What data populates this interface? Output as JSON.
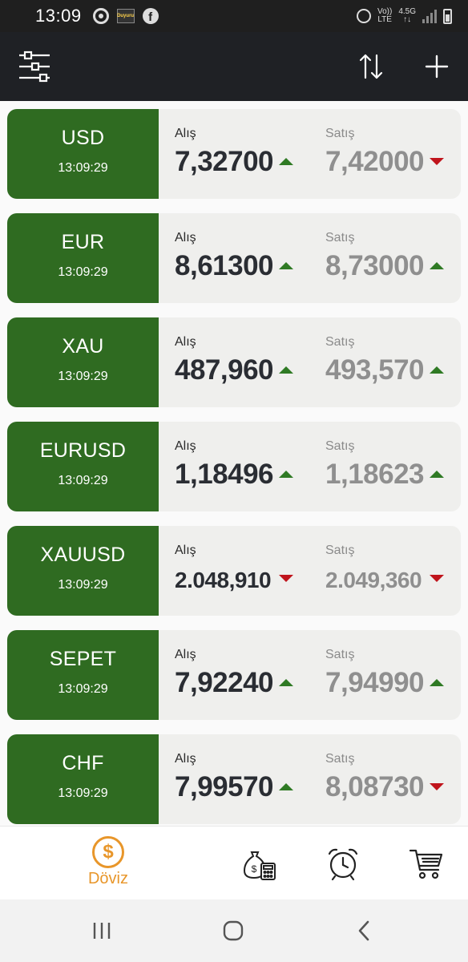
{
  "status_bar": {
    "time": "13:09",
    "app_icon_text": "Duyuru",
    "volte": "Vo))",
    "lte": "LTE",
    "network": "4.5G"
  },
  "colors": {
    "accent_green": "#2f6b21",
    "up_arrow": "#2f7a24",
    "down_arrow": "#c0141c",
    "active_tab": "#e8962a",
    "toolbar": "#1f2125"
  },
  "toolbar": {
    "filter_icon": "sliders-icon",
    "sort_icon": "sort-arrows-icon",
    "add_icon": "plus-icon"
  },
  "labels": {
    "buy": "Alış",
    "sell": "Satış"
  },
  "rates": [
    {
      "code": "USD",
      "time": "13:09:29",
      "buy": "7,32700",
      "buy_trend": "up",
      "sell": "7,42000",
      "sell_trend": "down"
    },
    {
      "code": "EUR",
      "time": "13:09:29",
      "buy": "8,61300",
      "buy_trend": "up",
      "sell": "8,73000",
      "sell_trend": "up"
    },
    {
      "code": "XAU",
      "time": "13:09:29",
      "buy": "487,960",
      "buy_trend": "up",
      "sell": "493,570",
      "sell_trend": "up"
    },
    {
      "code": "EURUSD",
      "time": "13:09:29",
      "buy": "1,18496",
      "buy_trend": "up",
      "sell": "1,18623",
      "sell_trend": "up"
    },
    {
      "code": "XAUUSD",
      "time": "13:09:29",
      "buy": "2.048,910",
      "buy_trend": "down",
      "sell": "2.049,360",
      "sell_trend": "down"
    },
    {
      "code": "SEPET",
      "time": "13:09:29",
      "buy": "7,92240",
      "buy_trend": "up",
      "sell": "7,94990",
      "sell_trend": "up"
    },
    {
      "code": "CHF",
      "time": "13:09:29",
      "buy": "7,99570",
      "buy_trend": "up",
      "sell": "8,08730",
      "sell_trend": "down"
    }
  ],
  "bottom_nav": {
    "active_label": "Döviz",
    "active_icon_glyph": "$",
    "items": [
      {
        "icon": "dollar-coin-icon",
        "label": "Döviz",
        "active": true
      },
      {
        "icon": "money-bag-calculator-icon",
        "active": false
      },
      {
        "icon": "alarm-clock-icon",
        "active": false
      },
      {
        "icon": "shopping-cart-icon",
        "active": false
      }
    ]
  }
}
